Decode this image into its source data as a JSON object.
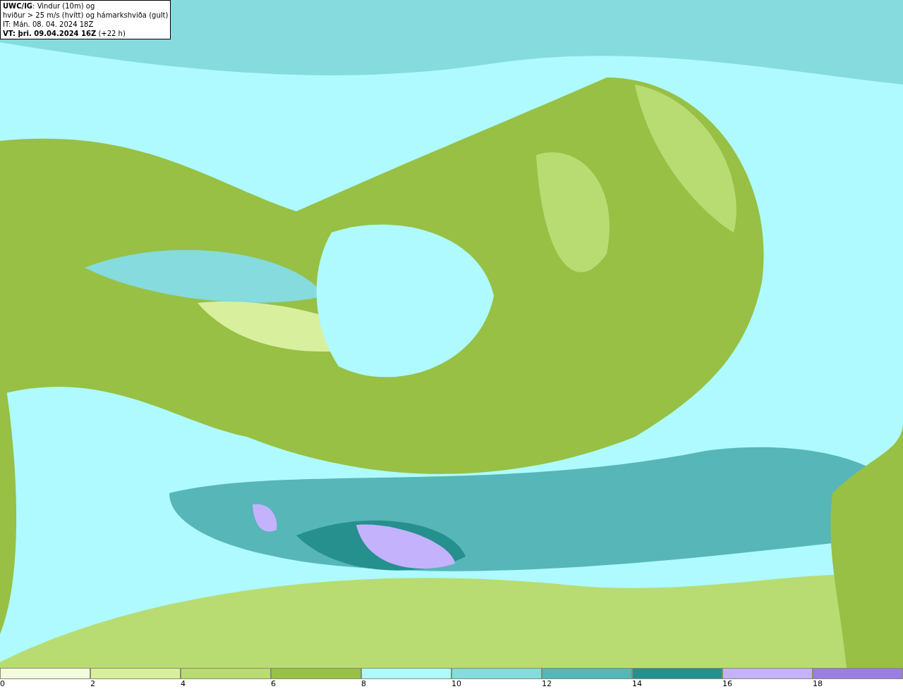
{
  "caption": {
    "lines": [
      "**UWC/IG**: Vindur (10m) og",
      "hviður > 25 m/s (hvítt) og hámarkshviða (gult)",
      "IT: Mán. 08. 04. 2024 18Z",
      "**VT: þri. 09.04.2024 16Z** (+22 h)"
    ]
  },
  "legend": {
    "bins": [
      {
        "color": "#f5fbe0"
      },
      {
        "color": "#d8f09e"
      },
      {
        "color": "#b8dc72"
      },
      {
        "color": "#97c045"
      },
      {
        "color": "#aefaff"
      },
      {
        "color": "#85dbdd"
      },
      {
        "color": "#56b6b8"
      },
      {
        "color": "#25908e"
      },
      {
        "color": "#c4b2fd"
      },
      {
        "color": "#9a7ee0"
      }
    ],
    "ticks": [
      "0",
      "2",
      "4",
      "6",
      "8",
      "10",
      "12",
      "14",
      "16",
      "18"
    ]
  }
}
